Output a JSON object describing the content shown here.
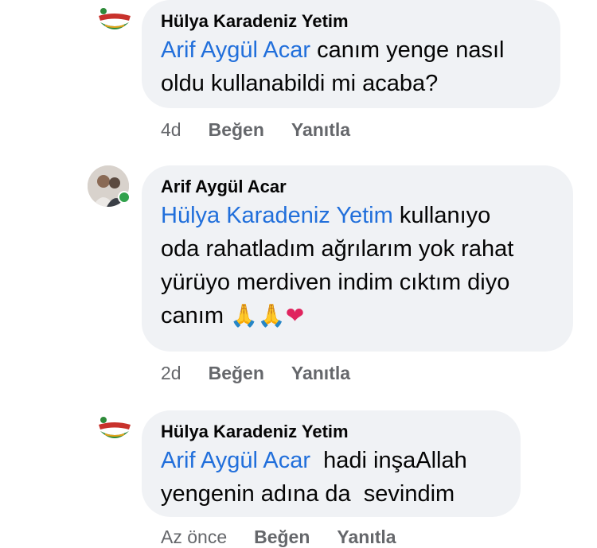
{
  "comments": [
    {
      "author": "Hülya Karadeniz Yetim",
      "mention": "Arif Aygül Acar",
      "text_line1_rest": " canım yenge nasıl",
      "text_line2": "oldu kullanabildi mi acaba?",
      "time": "4d",
      "like": "Beğen",
      "reply": "Yanıtla",
      "avatar_icon": "brand-logo-icon"
    },
    {
      "author": "Arif Aygül Acar",
      "mention": "Hülya Karadeniz Yetim",
      "text_line1_rest": " kullanıyo",
      "text_line2": "oda rahatladım ağrılarım yok rahat",
      "text_line3": "yürüyo merdiven indim cıktım diyo",
      "text_line4": "canım ",
      "emojis": [
        "🙏",
        "🙏",
        "❤"
      ],
      "time": "2d",
      "like": "Beğen",
      "reply": "Yanıtla",
      "avatar_icon": "profile-photo-icon",
      "online": true
    },
    {
      "author": "Hülya Karadeniz Yetim",
      "mention": "Arif Aygül Acar",
      "text_line1_rest": "  hadi inşaAllah",
      "text_line2": "yengenin adına da  sevindim",
      "time": "Az önce",
      "like": "Beğen",
      "reply": "Yanıtla",
      "avatar_icon": "brand-logo-icon"
    }
  ],
  "colors": {
    "bubble": "#f0f2f5",
    "mention": "#216fdb",
    "meta": "#65676b",
    "online": "#31a24c"
  }
}
